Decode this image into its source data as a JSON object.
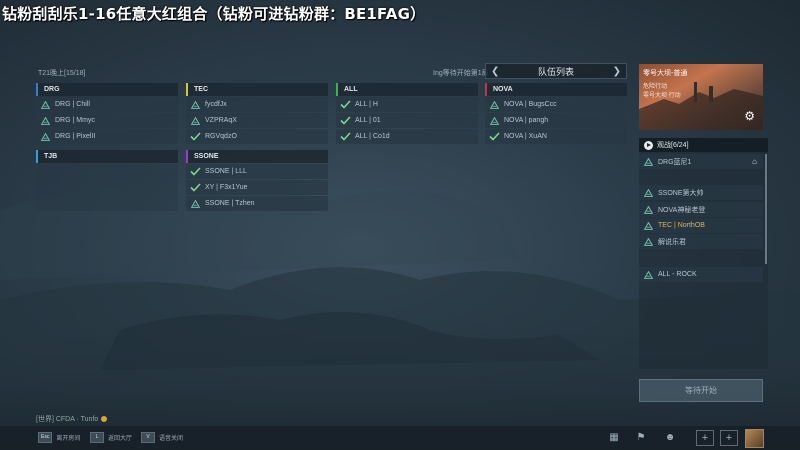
{
  "stream_title": "钻粉刮刮乐1-16任意大红组合（钻粉可进钻粉群：BE1FAG）",
  "lobby": {
    "room_label": "T21晚上[15/18]",
    "waiting_label": "Ing等待开始第1局"
  },
  "queue": {
    "title": "队伍列表",
    "prev_icon": "chevron-left-icon",
    "next_icon": "chevron-right-icon"
  },
  "teams": [
    {
      "tag": "DRG",
      "color": "#3a7cc8",
      "members": [
        {
          "name": "DRG | Chill",
          "status": "pending"
        },
        {
          "name": "DRG | Mmyc",
          "status": "pending"
        },
        {
          "name": "DRG | PixelII",
          "status": "pending"
        }
      ]
    },
    {
      "tag": "TEC",
      "color": "#d8c432",
      "members": [
        {
          "name": "fycdfJx",
          "status": "pending"
        },
        {
          "name": "VZPRAqX",
          "status": "pending"
        },
        {
          "name": "RGVqdzO",
          "status": "ready"
        }
      ]
    },
    {
      "tag": "ALL",
      "color": "#39b54a",
      "members": [
        {
          "name": "ALL | H",
          "status": "ready"
        },
        {
          "name": "ALL | 01",
          "status": "ready"
        },
        {
          "name": "ALL | Co1d",
          "status": "ready"
        }
      ]
    },
    {
      "tag": "NOVA",
      "color": "#c8324e",
      "members": [
        {
          "name": "NOVA | BugsCcc",
          "status": "pending"
        },
        {
          "name": "NOVA | pangh",
          "status": "pending"
        },
        {
          "name": "NOVA | XuAN",
          "status": "ready"
        }
      ]
    },
    {
      "tag": "TJB",
      "color": "#3a9cd8",
      "members": []
    },
    {
      "tag": "SSONE",
      "color": "#9a3ad0",
      "members": [
        {
          "name": "SSONE | LLL",
          "status": "ready"
        },
        {
          "name": "XY | F3x1Yue",
          "status": "ready"
        },
        {
          "name": "SSONE | Tzhen",
          "status": "pending"
        }
      ]
    }
  ],
  "preview": {
    "title": "零号大坝-普通",
    "line1": "危险行动",
    "line2": "零号大坝 行动",
    "settings_icon": "gear-icon"
  },
  "spectators": {
    "title": "观战[6/24]",
    "rows": [
      {
        "name": "DRG蓝尼1",
        "highlight": false,
        "host": true
      },
      {
        "name": "SSONE第大帅",
        "highlight": false,
        "host": false
      },
      {
        "name": "NOVA神秘老登",
        "highlight": false,
        "host": false
      },
      {
        "name": "TEC | NorthOB",
        "highlight": true,
        "host": false
      },
      {
        "name": "解说乐君",
        "highlight": false,
        "host": false
      },
      {
        "name": "ALL - ROCK",
        "highlight": false,
        "host": false
      }
    ]
  },
  "start_button": "等待开始",
  "chat": {
    "text": "[世界] CFDA · Tunfo"
  },
  "bottom_hints": [
    {
      "key": "Esc",
      "label": "离开房间"
    },
    {
      "key": "L",
      "label": "返回大厅"
    },
    {
      "key": "V",
      "label": "语音关闭"
    }
  ],
  "colors": {
    "ready_check": "#7fd68a",
    "pending_triangle": "#6fc2a8",
    "highlight_text": "#e0b54a"
  }
}
